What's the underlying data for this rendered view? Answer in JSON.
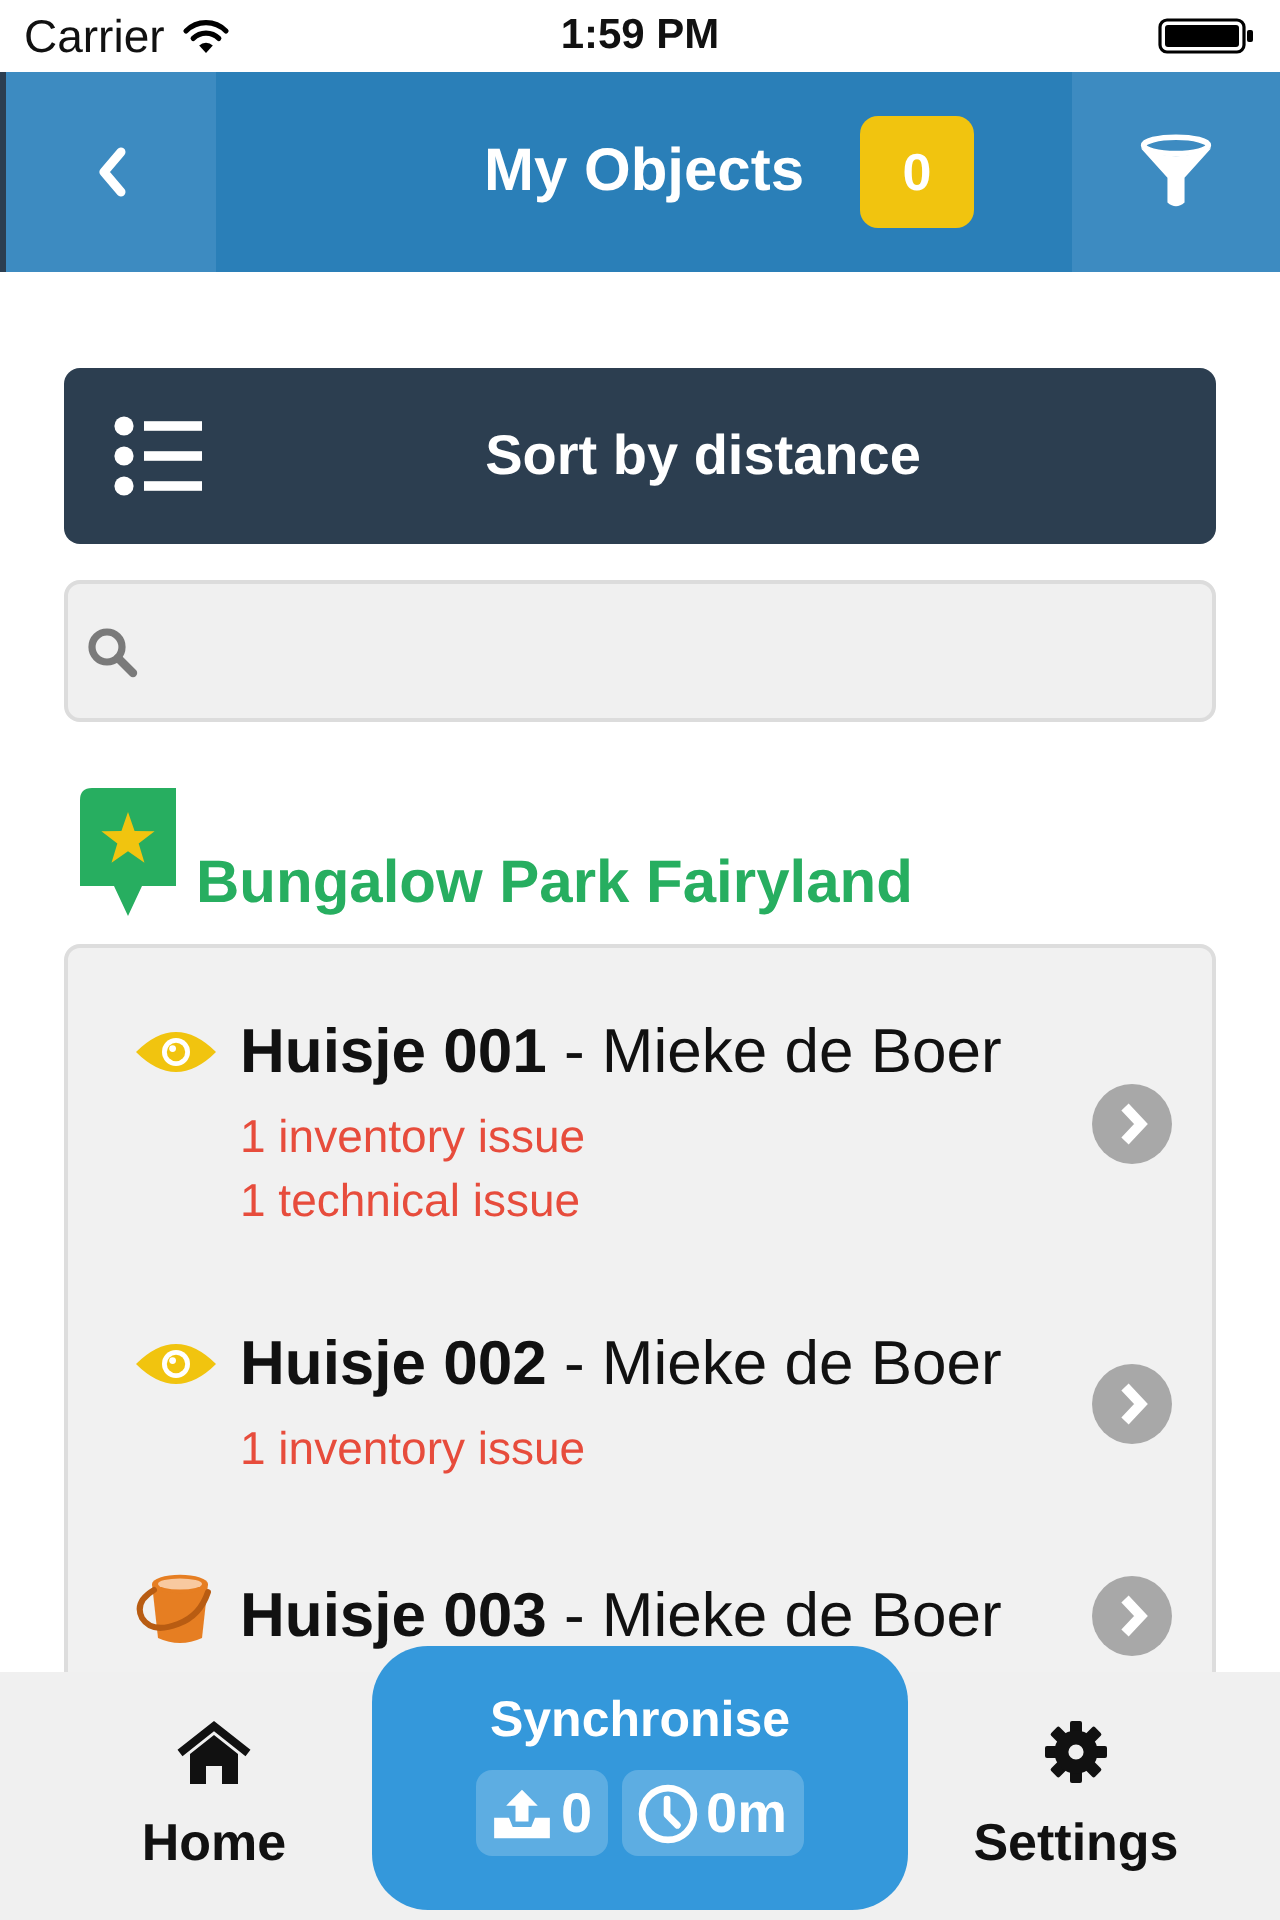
{
  "status_bar": {
    "carrier": "Carrier",
    "time": "1:59 PM"
  },
  "nav_bar": {
    "title": "My Objects",
    "badge": "0"
  },
  "sort_button": {
    "label": "Sort by distance"
  },
  "groups": [
    {
      "title": "Bungalow Park Fairyland",
      "objects": [
        {
          "kind": "eye",
          "title": "**Huisje 001** - Mieke de Boer",
          "issues": [
            "1 inventory issue",
            "1 technical issue"
          ]
        },
        {
          "kind": "eye",
          "title": "**Huisje 002** - Mieke de Boer",
          "issues": [
            "1 inventory issue"
          ]
        },
        {
          "kind": "bucket",
          "title": "**Huisje 003** - Mieke de Boer"
        }
      ]
    }
  ],
  "tab_bar": [
    {
      "kind": "home",
      "label": "Home"
    },
    {
      "kind": "sync",
      "label": "Synchronise",
      "uploads": "0",
      "last_sync": "0m"
    },
    {
      "kind": "settings",
      "label": "Settings"
    }
  ]
}
